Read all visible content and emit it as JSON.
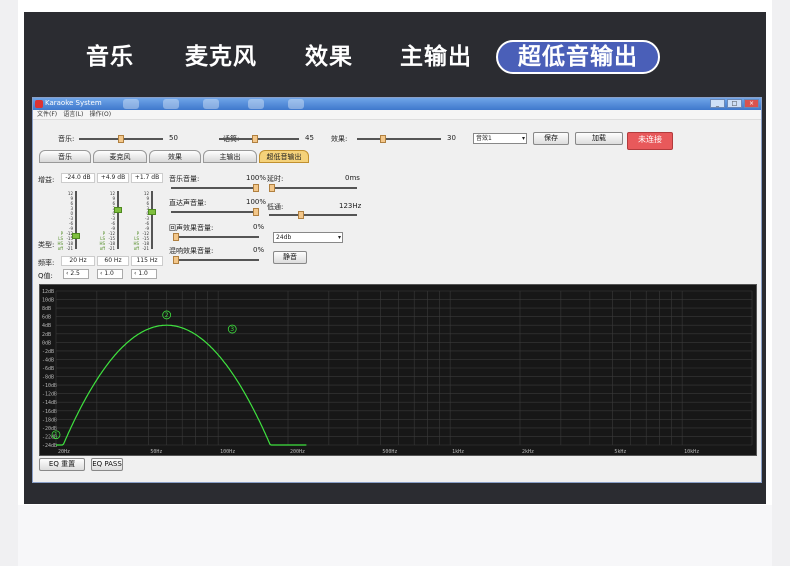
{
  "nav": {
    "tabs": [
      {
        "label": "音乐"
      },
      {
        "label": "麦克风"
      },
      {
        "label": "效果"
      },
      {
        "label": "主输出"
      },
      {
        "label": "超低音输出"
      }
    ],
    "active_index": 4
  },
  "window": {
    "title": "Karaoke System",
    "menu": [
      "文件(F)",
      "语言(L)",
      "操作(O)"
    ],
    "buttons": [
      "_",
      "□",
      "×"
    ]
  },
  "controls": {
    "music": {
      "label": "音乐:",
      "value": "50",
      "level": 0.5
    },
    "talk": {
      "label": "话筒:",
      "value": "45",
      "level": 0.45
    },
    "effect": {
      "label": "效果:",
      "value": "30",
      "level": 0.3
    },
    "preset": "音效1",
    "save": "保存",
    "load": "加载",
    "status": "未连接"
  },
  "subtabs": [
    "音乐",
    "麦克风",
    "效果",
    "主输出",
    "超低音输出"
  ],
  "eq": {
    "gain_label": "增益:",
    "type_label": "类型:",
    "freq_label": "频率:",
    "q_label": "Q值:",
    "bands": [
      {
        "gain": "-24.0 dB",
        "freq": "20 Hz",
        "q": "2.5",
        "level": 0.8
      },
      {
        "gain": "+4.9 dB",
        "freq": "60 Hz",
        "q": "1.0",
        "level": 0.3
      },
      {
        "gain": "+1.7 dB",
        "freq": "115 Hz",
        "q": "1.0",
        "level": 0.35
      }
    ],
    "scale": [
      "12",
      "9",
      "6",
      "3",
      "0",
      "-3",
      "-6",
      "-9",
      "-12",
      "-15",
      "-18",
      "-21",
      "-24",
      "-24"
    ],
    "type_marks": [
      "P",
      "LS",
      "HS",
      "off"
    ]
  },
  "mix": {
    "music_level": {
      "label": "音乐音量:",
      "value": "100%",
      "level": 1.0
    },
    "direct_level": {
      "label": "直达声音量:",
      "value": "100%",
      "level": 1.0
    },
    "echo_level": {
      "label": "回声效果音量:",
      "value": "0%",
      "level": 0.0
    },
    "reverb_level": {
      "label": "混响效果音量:",
      "value": "0%",
      "level": 0.0
    },
    "delay": {
      "label": "延时:",
      "value": "0ms",
      "level": 0.0
    },
    "lowpass": {
      "label": "低通:",
      "value": "123Hz",
      "level": 0.35
    },
    "slope": "24db",
    "mute": "静音"
  },
  "graph": {
    "y_ticks": [
      "12dB",
      "10dB",
      "8dB",
      "6dB",
      "4dB",
      "2dB",
      "0dB",
      "-2dB",
      "-4dB",
      "-6dB",
      "-8dB",
      "-10dB",
      "-12dB",
      "-14dB",
      "-16dB",
      "-18dB",
      "-20dB",
      "-22dB",
      "-24dB"
    ],
    "x_ticks": [
      "20Hz",
      "50Hz",
      "100Hz",
      "200Hz",
      "500Hz",
      "1kHz",
      "2kHz",
      "5kHz",
      "10kHz"
    ],
    "markers": [
      "1",
      "2",
      "3"
    ],
    "reset": "EQ 重置",
    "pass": "EQ PASS"
  }
}
